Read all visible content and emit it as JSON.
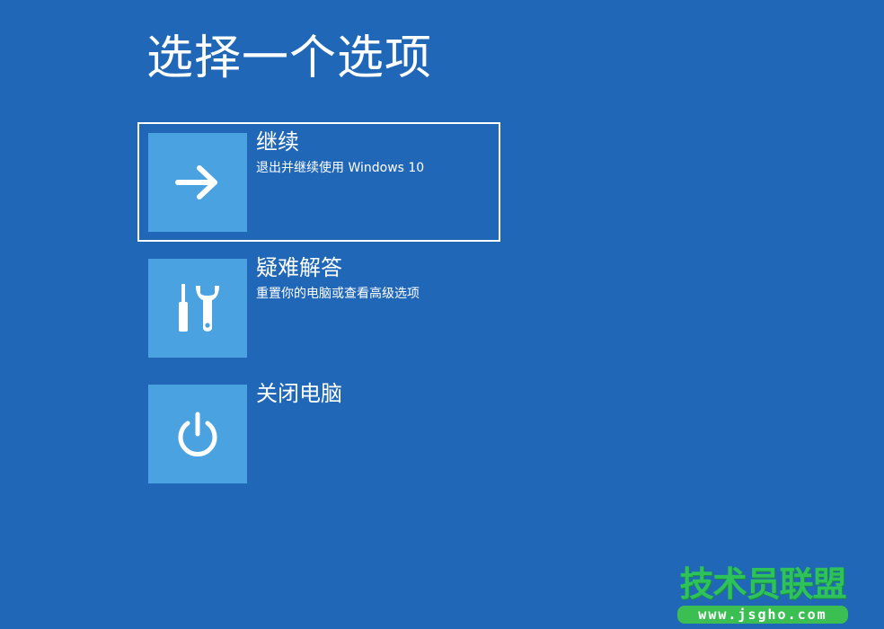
{
  "screen": {
    "title": "选择一个选项",
    "background_color": "#2067b7",
    "tile_color": "#4aa3e0"
  },
  "options": [
    {
      "label": "继续",
      "description": "退出并继续使用 Windows 10",
      "icon": "arrow-right-icon",
      "focused": true
    },
    {
      "label": "疑难解答",
      "description": "重置你的电脑或查看高级选项",
      "icon": "tools-icon",
      "focused": false
    },
    {
      "label": "关闭电脑",
      "description": "",
      "icon": "power-icon",
      "focused": false
    }
  ],
  "watermark": {
    "brand": "技术员联盟",
    "url": "www.jsgho.com",
    "brand_color": "#2ec35a"
  }
}
